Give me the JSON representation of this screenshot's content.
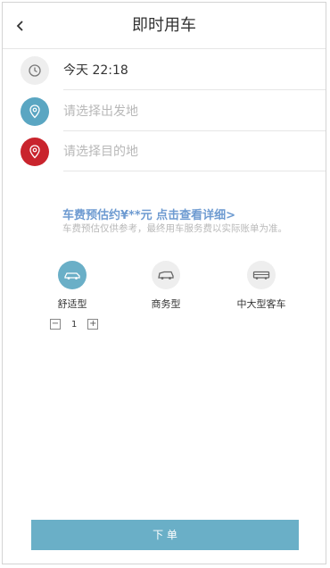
{
  "header": {
    "title": "即时用车",
    "back_icon": "chevron-left-icon"
  },
  "form": {
    "time": {
      "value": "今天 22:18",
      "icon": "clock-icon"
    },
    "origin": {
      "placeholder": "请选择出发地",
      "icon": "location-pin-icon",
      "color": "#5aa6c2"
    },
    "destination": {
      "placeholder": "请选择目的地",
      "icon": "location-pin-icon",
      "color": "#c9242d"
    }
  },
  "fare": {
    "estimate": "车费预估约¥**元 点击查看详细>",
    "note": "车费预估仅供参考，最终用车服务费以实际账单为准。"
  },
  "car_types": [
    {
      "label": "舒适型",
      "icon": "sedan-icon",
      "selected": true
    },
    {
      "label": "商务型",
      "icon": "mpv-icon",
      "selected": false
    },
    {
      "label": "中大型客车",
      "icon": "bus-icon",
      "selected": false
    }
  ],
  "quantity": {
    "minus": "−",
    "value": "1",
    "plus": "+"
  },
  "submit": {
    "label": "下 单"
  },
  "colors": {
    "accent": "#6aafc7",
    "link": "#6e9bd1",
    "origin_pin": "#5aa6c2",
    "destination_pin": "#c9242d"
  }
}
